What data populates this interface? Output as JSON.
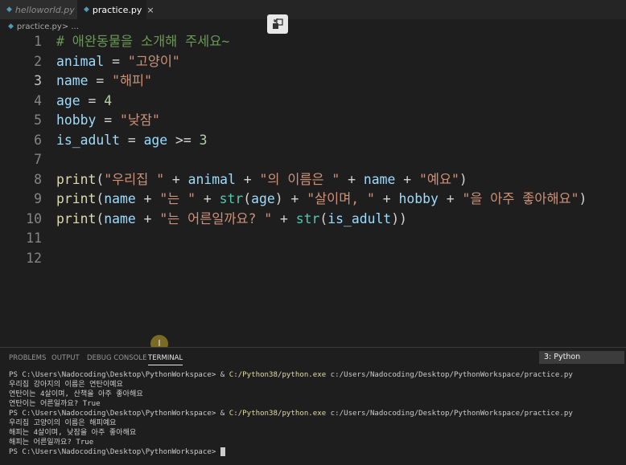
{
  "tabs": [
    {
      "label": "helloworld.py",
      "icon": "python-file-icon"
    },
    {
      "label": "practice.py",
      "icon": "python-file-icon",
      "close": "×"
    }
  ],
  "breadcrumb": {
    "file": "practice.py",
    "sep": " > ..."
  },
  "editor": {
    "lines": [
      {
        "n": "1",
        "tokens": [
          [
            "cmt",
            "# 애완동물을 소개해 주세요~"
          ]
        ]
      },
      {
        "n": "2",
        "tokens": [
          [
            "var",
            "animal"
          ],
          [
            "op",
            " = "
          ],
          [
            "str",
            "\"고양이\""
          ]
        ]
      },
      {
        "n": "3",
        "tokens": [
          [
            "var",
            "name"
          ],
          [
            "op",
            " = "
          ],
          [
            "str",
            "\"해피\""
          ]
        ]
      },
      {
        "n": "4",
        "tokens": [
          [
            "var",
            "age"
          ],
          [
            "op",
            " = "
          ],
          [
            "num",
            "4"
          ]
        ]
      },
      {
        "n": "5",
        "tokens": [
          [
            "var",
            "hobby"
          ],
          [
            "op",
            " = "
          ],
          [
            "str",
            "\"낮잠\""
          ]
        ]
      },
      {
        "n": "6",
        "tokens": [
          [
            "var",
            "is_adult"
          ],
          [
            "op",
            " = "
          ],
          [
            "var",
            "age"
          ],
          [
            "op",
            " >= "
          ],
          [
            "num",
            "3"
          ]
        ]
      },
      {
        "n": "7",
        "tokens": []
      },
      {
        "n": "8",
        "tokens": [
          [
            "fn",
            "print"
          ],
          [
            "op",
            "("
          ],
          [
            "str",
            "\"우리집 \""
          ],
          [
            "op",
            " + "
          ],
          [
            "var",
            "animal"
          ],
          [
            "op",
            " + "
          ],
          [
            "str",
            "\"의 이름은 \""
          ],
          [
            "op",
            " + "
          ],
          [
            "var",
            "name"
          ],
          [
            "op",
            " + "
          ],
          [
            "str",
            "\"예요\""
          ],
          [
            "op",
            ")"
          ]
        ]
      },
      {
        "n": "9",
        "tokens": [
          [
            "fn",
            "print"
          ],
          [
            "op",
            "("
          ],
          [
            "var",
            "name"
          ],
          [
            "op",
            " + "
          ],
          [
            "str",
            "\"는 \""
          ],
          [
            "op",
            " + "
          ],
          [
            "bi",
            "str"
          ],
          [
            "op",
            "("
          ],
          [
            "var",
            "age"
          ],
          [
            "op",
            ") + "
          ],
          [
            "str",
            "\"살이며, \""
          ],
          [
            "op",
            " + "
          ],
          [
            "var",
            "hobby"
          ],
          [
            "op",
            " + "
          ],
          [
            "str",
            "\"을 아주 좋아해요\""
          ],
          [
            "op",
            ")"
          ]
        ]
      },
      {
        "n": "10",
        "tokens": [
          [
            "fn",
            "print"
          ],
          [
            "op",
            "("
          ],
          [
            "var",
            "name"
          ],
          [
            "op",
            " + "
          ],
          [
            "str",
            "\"는 어른일까요? \""
          ],
          [
            "op",
            " + "
          ],
          [
            "bi",
            "str"
          ],
          [
            "op",
            "("
          ],
          [
            "var",
            "is_adult"
          ],
          [
            "op",
            "))"
          ]
        ]
      },
      {
        "n": "11",
        "tokens": []
      },
      {
        "n": "12",
        "tokens": []
      }
    ]
  },
  "cursor_indicator": "I",
  "panel": {
    "tabs": [
      "PROBLEMS",
      "OUTPUT",
      "DEBUG CONSOLE",
      "TERMINAL"
    ],
    "active_tab": "TERMINAL",
    "terminal_selector": "3: Python"
  },
  "terminal": [
    {
      "prompt": "PS C:\\Users\\Nadocoding\\Desktop\\PythonWorkspace> & ",
      "exe": "C:/Python38/python.exe",
      "rest": " c:/Users/Nadocoding/Desktop/PythonWorkspace/practice.py"
    },
    {
      "text": "우리집 강아지의 이름은 연탄이예요"
    },
    {
      "text": "연탄이는 4살이며, 산책을 아주 좋아해요"
    },
    {
      "text": "연탄이는 어른일까요? True"
    },
    {
      "prompt": "PS C:\\Users\\Nadocoding\\Desktop\\PythonWorkspace> & ",
      "exe": "C:/Python38/python.exe",
      "rest": " c:/Users/Nadocoding/Desktop/PythonWorkspace/practice.py"
    },
    {
      "text": "우리집 고양이의 이름은 해피예요"
    },
    {
      "text": "해피는 4살이며, 낮잠을 아주 좋아해요"
    },
    {
      "text": "해피는 어른일까요? True"
    },
    {
      "text": "PS C:\\Users\\Nadocoding\\Desktop\\PythonWorkspace> ",
      "cursor": true
    }
  ],
  "colors": {
    "editor_bg": "#1e1e1e",
    "string": "#ce9178",
    "variable": "#9cdcfe",
    "function": "#dcdcaa",
    "builtin": "#4ec9b0",
    "comment": "#6a9955",
    "number": "#b5cea8"
  }
}
